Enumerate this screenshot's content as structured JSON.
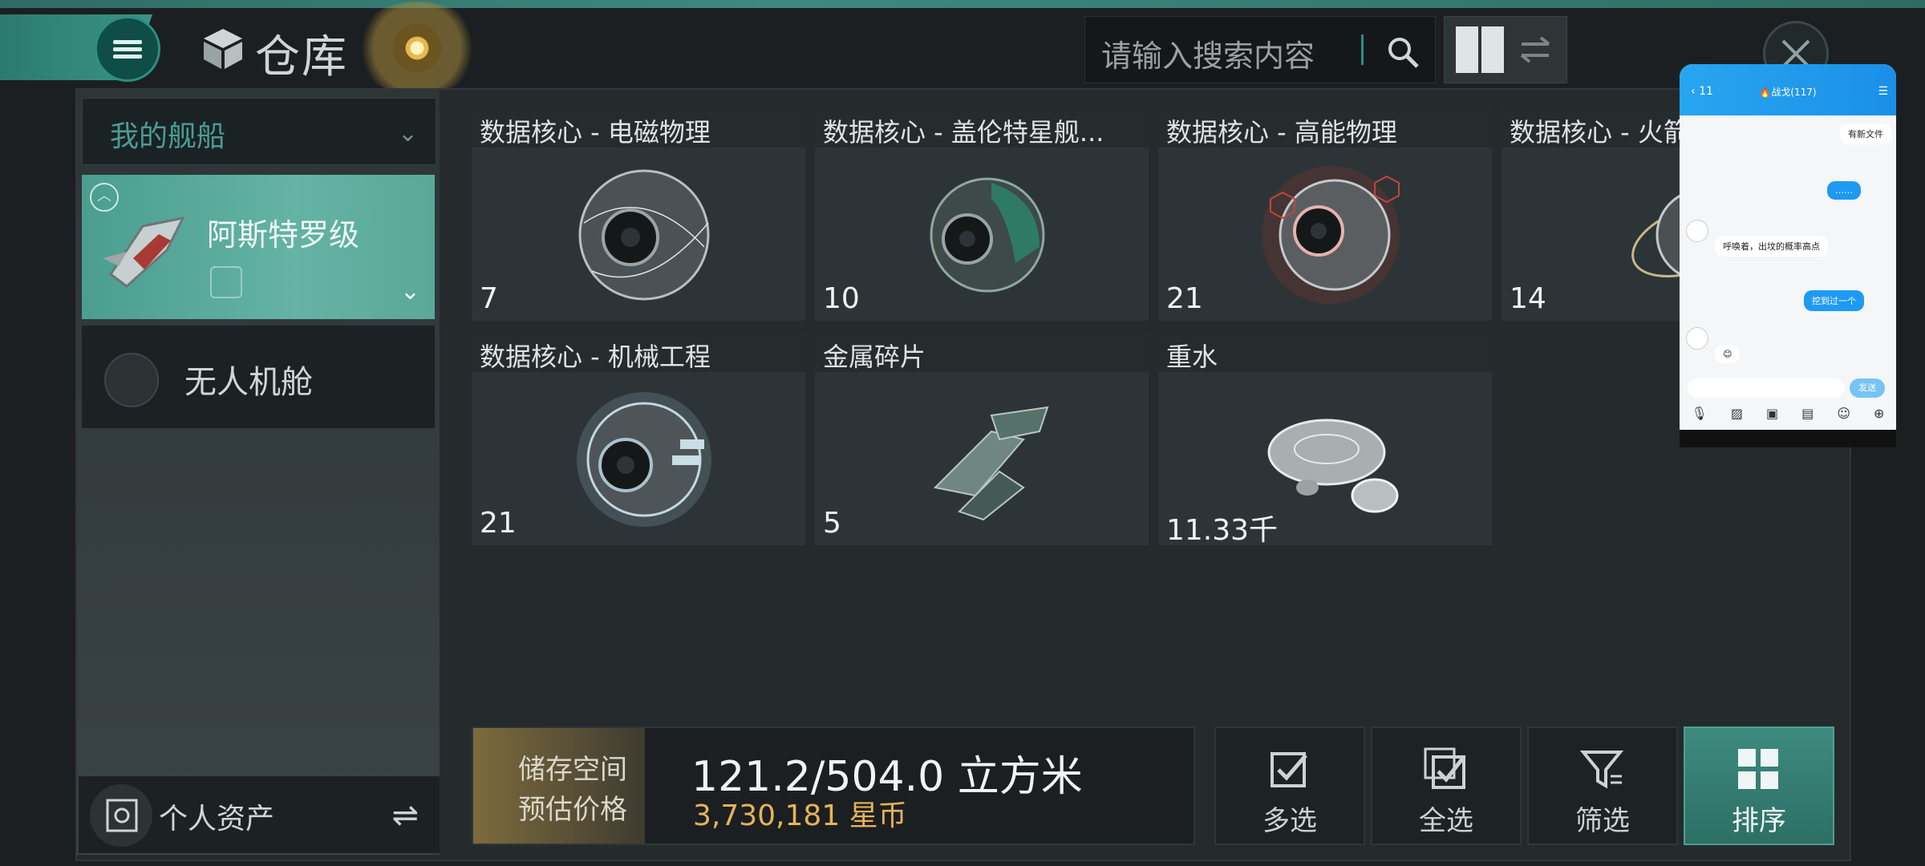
{
  "header": {
    "title": "仓库",
    "search_placeholder": "请输入搜索内容"
  },
  "sidebar": {
    "ship_selector": "我的舰船",
    "ship_card_name": "阿斯特罗级",
    "drone_bay": "无人机舱",
    "personal_assets": "个人资产"
  },
  "items": [
    {
      "name": "数据核心 - 电磁物理",
      "qty": "7"
    },
    {
      "name": "数据核心 - 盖伦特星舰...",
      "qty": "10"
    },
    {
      "name": "数据核心 - 高能物理",
      "qty": "21"
    },
    {
      "name": "数据核心 - 火箭",
      "qty": "14"
    },
    {
      "name": "数据核心 - 机械工程",
      "qty": "21"
    },
    {
      "name": "金属碎片",
      "qty": "5"
    },
    {
      "name": "重水",
      "qty": "11.33千"
    }
  ],
  "storage": {
    "label_space": "储存空间",
    "label_price": "预估价格",
    "capacity": "121.2/504.0 立方米",
    "price": "3,730,181 星币"
  },
  "actions": {
    "multi_select": "多选",
    "select_all": "全选",
    "filter": "筛选",
    "sort": "排序"
  },
  "chat": {
    "title": "🔥战戈(117)",
    "unread": "11",
    "file_msg": "有新文件",
    "msg1": "……",
    "msg2": "呼唤着，出坟的概率高点",
    "msg3": "挖到过一个",
    "msg4": "😊",
    "send": "发送"
  }
}
